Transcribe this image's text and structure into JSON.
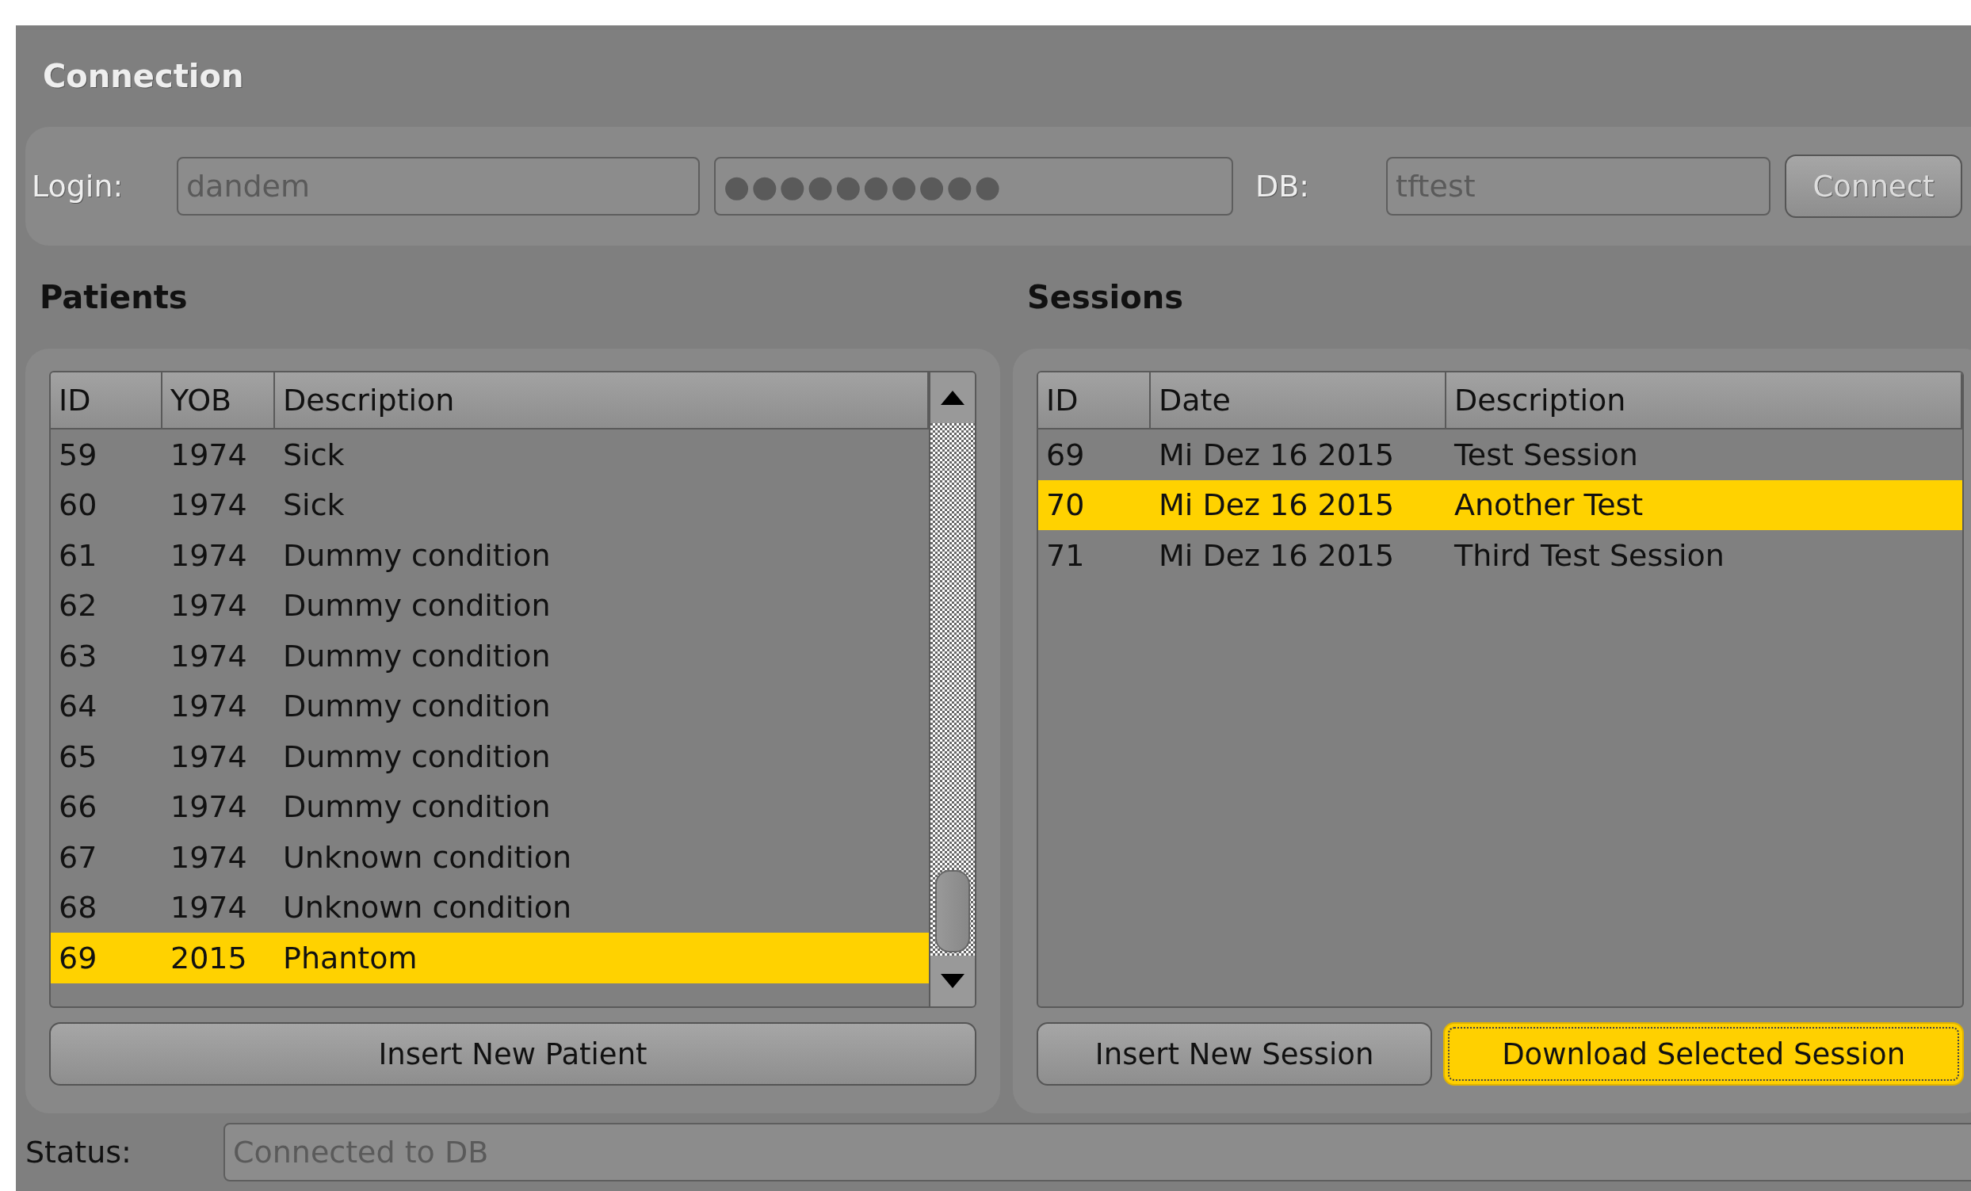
{
  "connection": {
    "title": "Connection",
    "login_label": "Login:",
    "login": {
      "value": "dandem",
      "disabled": true
    },
    "password": {
      "value": "●●●●●●●●●●",
      "disabled": true
    },
    "db_label": "DB:",
    "db": {
      "value": "tftest",
      "disabled": true
    },
    "connect_button": {
      "label": "Connect",
      "disabled": true
    }
  },
  "patients": {
    "title": "Patients",
    "columns": [
      "ID",
      "YOB",
      "Description"
    ],
    "rows": [
      {
        "cells": [
          "59",
          "1974",
          "Sick"
        ],
        "selected": false
      },
      {
        "cells": [
          "60",
          "1974",
          "Sick"
        ],
        "selected": false
      },
      {
        "cells": [
          "61",
          "1974",
          "Dummy condition"
        ],
        "selected": false
      },
      {
        "cells": [
          "62",
          "1974",
          "Dummy condition"
        ],
        "selected": false
      },
      {
        "cells": [
          "63",
          "1974",
          "Dummy condition"
        ],
        "selected": false
      },
      {
        "cells": [
          "64",
          "1974",
          "Dummy condition"
        ],
        "selected": false
      },
      {
        "cells": [
          "65",
          "1974",
          "Dummy condition"
        ],
        "selected": false
      },
      {
        "cells": [
          "66",
          "1974",
          "Dummy condition"
        ],
        "selected": false
      },
      {
        "cells": [
          "67",
          "1974",
          "Unknown condition"
        ],
        "selected": false
      },
      {
        "cells": [
          "68",
          "1974",
          "Unknown condition"
        ],
        "selected": false
      },
      {
        "cells": [
          "69",
          "2015",
          "Phantom"
        ],
        "selected": true
      }
    ],
    "buttons": [
      {
        "label": "Insert New Patient",
        "focused": false
      }
    ]
  },
  "sessions": {
    "title": "Sessions",
    "columns": [
      "ID",
      "Date",
      "Description"
    ],
    "rows": [
      {
        "cells": [
          "69",
          "Mi Dez 16 2015",
          "Test Session"
        ],
        "selected": false
      },
      {
        "cells": [
          "70",
          "Mi Dez 16 2015",
          "Another Test"
        ],
        "selected": true
      },
      {
        "cells": [
          "71",
          "Mi Dez 16 2015",
          "Third Test Session"
        ],
        "selected": false
      }
    ],
    "buttons": [
      {
        "label": "Insert New Session",
        "focused": false
      },
      {
        "label": "Download Selected Session",
        "focused": true
      }
    ]
  },
  "status": {
    "label": "Status:",
    "value": "Connected to DB",
    "disabled": true
  }
}
